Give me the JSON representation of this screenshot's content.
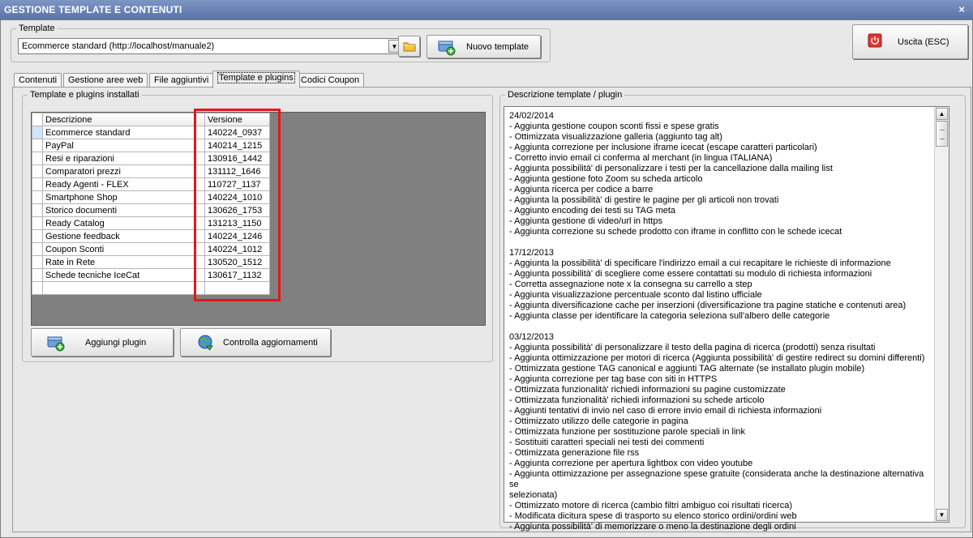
{
  "window": {
    "title": "GESTIONE TEMPLATE E CONTENUTI",
    "close_glyph": "×"
  },
  "template_group": {
    "legend": "Template",
    "selected": "Ecommerce standard (http://localhost/manuale2)",
    "dropdown_glyph": "▼",
    "new_template_label": "Nuovo template"
  },
  "exit_label": "Uscita (ESC)",
  "tabs": [
    {
      "label": "Contenuti"
    },
    {
      "label": "Gestione aree web"
    },
    {
      "label": "File aggiuntivi"
    },
    {
      "label": "Template e plugins"
    },
    {
      "label": "Codici Coupon"
    }
  ],
  "plugins_group": {
    "legend": "Template e plugins installati",
    "columns": [
      "Descrizione",
      "Versione"
    ],
    "rows": [
      [
        "Ecommerce standard",
        "140224_0937"
      ],
      [
        "PayPal",
        "140214_1215"
      ],
      [
        "Resi e riparazioni",
        "130916_1442"
      ],
      [
        "Comparatori prezzi",
        "131112_1646"
      ],
      [
        "Ready Agenti - FLEX",
        "110727_1137"
      ],
      [
        "Smartphone Shop",
        "140224_1010"
      ],
      [
        "Storico documenti",
        "130626_1753"
      ],
      [
        "Ready Catalog",
        "131213_1150"
      ],
      [
        "Gestione feedback",
        "140224_1246"
      ],
      [
        "Coupon Sconti",
        "140224_1012"
      ],
      [
        "Rate in Rete",
        "130520_1512"
      ],
      [
        "Schede tecniche IceCat",
        "130617_1132"
      ]
    ],
    "add_plugin_label": "Aggiungi plugin",
    "check_updates_label": "Controlla aggiornamenti"
  },
  "description_group": {
    "legend": "Descrizione template / plugin",
    "lines": [
      "24/02/2014",
      "- Aggiunta gestione coupon sconti fissi e spese gratis",
      "- Ottimizzata visualizzazione galleria (aggiunto tag alt)",
      "- Aggiunta correzione per inclusione iframe icecat (escape caratteri particolari)",
      "- Corretto invio email ci conferma al merchant (in lingua ITALIANA)",
      "- Aggiunta possibilità' di personalizzare i testi per la cancellazione dalla mailing list",
      "- Aggiunta gestione foto Zoom su scheda articolo",
      "- Aggiunta ricerca per codice a barre",
      "- Aggiunta la possibilità' di gestire le pagine per gli articoli non trovati",
      "- Aggiunto encoding dei testi su TAG meta",
      "- Aggiunta gestione di video/url in https",
      "- Aggiunta correzione su schede prodotto con iframe in conflitto con le schede icecat",
      "",
      "17/12/2013",
      "- Aggiunta la possibilità' di specificare l'indirizzo email a cui recapitare le richieste di informazione",
      "- Aggiunta possibilità' di scegliere come essere contattati su modulo di richiesta informazioni",
      "- Corretta assegnazione note x la consegna su carrello a step",
      "- Aggiunta visualizzazione percentuale sconto dal listino ufficiale",
      "- Aggiunta diversificazione cache per inserzioni (diversificazione tra pagine statiche e contenuti area)",
      "- Aggiunta classe per identificare la categoria seleziona sull'albero delle categorie",
      "",
      "03/12/2013",
      "- Aggiunta possibilità' di personalizzare il testo della pagina di ricerca (prodotti) senza risultati",
      "- Aggiunta ottimizzazione per motori di ricerca (Aggiunta possibilità' di gestire redirect su domini differenti)",
      "- Ottimizzata gestione TAG canonical e aggiunti TAG alternate (se installato plugin mobile)",
      "- Aggiunta correzione per tag base con siti in HTTPS",
      "- Ottimizzata funzionalità' richiedi informazioni su pagine customizzate",
      "- Ottimizzata funzionalità' richiedi informazioni su schede articolo",
      "- Aggiunti tentativi di invio nel caso di errore invio email di richiesta informazioni",
      "- Ottimizzato utilizzo delle categorie in pagina",
      "- Ottimizzata funzione per sostituzione parole speciali in link",
      "- Sostituiti caratteri speciali nei testi dei commenti",
      "- Ottimizzata generazione file rss",
      "- Aggiunta correzione per apertura lightbox con video youtube",
      "- Aggiunta ottimizzazione per assegnazione spese gratuite (considerata anche la destinazione alternativa se",
      "selezionata)",
      "- Ottimizzato motore di ricerca (cambio filtri ambiguo coi risultati ricerca)",
      "- Modificata dicitura spese di trasporto su elenco storico ordini/ordini web",
      "- Aggiunta possibilità' di memorizzare o meno la destinazione degli ordini"
    ],
    "scroll_up_glyph": "▲",
    "scroll_down_glyph": "▼"
  },
  "colors": {
    "titlebar": "#6a82b6",
    "highlight": "#e8141b",
    "grid_background": "#808080"
  }
}
